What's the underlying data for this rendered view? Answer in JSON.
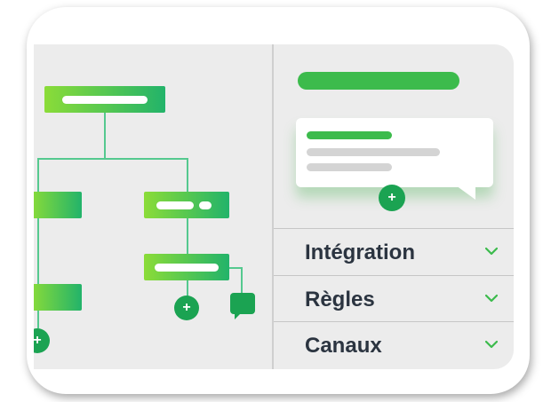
{
  "flow": {
    "add_symbol": "+"
  },
  "side_panel": {
    "accordion": [
      {
        "label": "Intégration"
      },
      {
        "label": "Règles"
      },
      {
        "label": "Canaux"
      }
    ],
    "add_symbol": "+"
  },
  "colors": {
    "accent": "#1ba352",
    "node_gradient_start": "#8bdc38",
    "node_gradient_end": "#22b36a",
    "panel_bg": "#ececec",
    "text_dark": "#2b3440"
  },
  "icons": [
    "plus-icon",
    "chat-icon",
    "chevron-down-icon"
  ]
}
